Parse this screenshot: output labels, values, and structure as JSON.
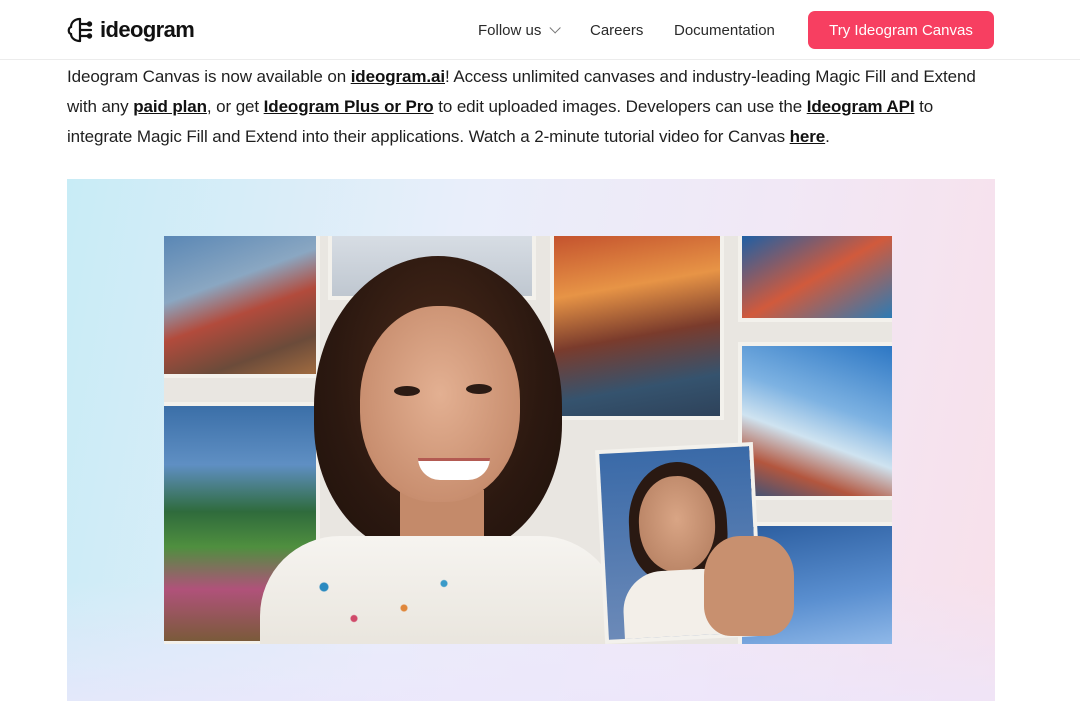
{
  "header": {
    "logo_text": "ideogram",
    "nav": {
      "follow_us": "Follow us",
      "careers": "Careers",
      "documentation": "Documentation"
    },
    "cta_label": "Try Ideogram Canvas"
  },
  "intro": {
    "t1": "Ideogram Canvas is now available on ",
    "link1": "ideogram.ai",
    "t2": "! Access unlimited canvases and industry-leading Magic Fill and Extend with any ",
    "link2": "paid plan",
    "t3": ", or get ",
    "link3": "Ideogram Plus or Pro",
    "t4": " to edit uploaded images. Developers can use the ",
    "link4": "Ideogram API",
    "t5": " to integrate Magic Fill and Extend into their applications. Watch a 2-minute tutorial video for Canvas ",
    "link5": "here",
    "t6": "."
  },
  "icons": {
    "logo": "ideogram-brain-icon",
    "chevron": "chevron-down-icon"
  },
  "colors": {
    "cta_background": "#f73f61",
    "cta_text": "#ffffff"
  }
}
